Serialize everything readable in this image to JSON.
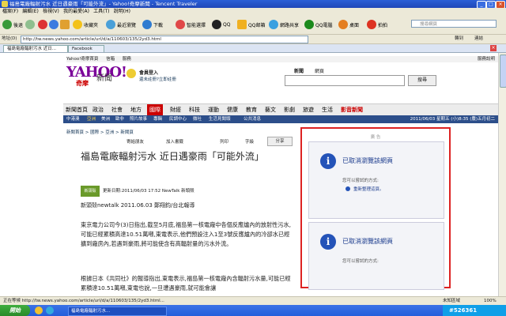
{
  "window": {
    "title": "福島電廠輻射污水 近日遇豪雨「可能外流」- Yahoo!奇摩新聞 - Tencent Traveler",
    "controls": {
      "minimize": "_",
      "maximize": "□",
      "close": "×"
    }
  },
  "menubar": [
    "檔案(F)",
    "編輯(E)",
    "檢視(V)",
    "我的最愛(A)",
    "工具(T)",
    "說明(H)"
  ],
  "toolbar": {
    "items": [
      "後退",
      "前進",
      "停止",
      "刷新",
      "主頁",
      "收藏夾",
      "最近瀏覽",
      "下載",
      "智能選擇",
      "QQ",
      "QQ邮箱",
      "網路共享",
      "QQ電腦",
      "桌面",
      "拍拍"
    ],
    "search_placeholder": "搜尋網頁"
  },
  "address": {
    "label": "地址(D)",
    "url": "http://tw.news.yahoo.com/article/url/d/a/110603/135/2yd3.html",
    "go": "轉到",
    "links_label": "連結"
  },
  "tabs": [
    {
      "label": "福島電廠輻射污水 近日...",
      "active": true
    },
    {
      "label": "Facebook",
      "active": false
    }
  ],
  "yahoo": {
    "top_links": [
      "Yahoo!奇摩首頁",
      "信箱",
      "服務"
    ],
    "top_right": "服務說明",
    "logo": "YAHOO!",
    "logo_sub": "奇摩",
    "brand": "新聞",
    "login_label": "會員登入",
    "login_hint": "還未註冊?立即註冊",
    "search_tabs": [
      "新聞",
      "網頁"
    ],
    "search_button": "搜尋",
    "nav_items": [
      "新聞首頁",
      "政治",
      "社會",
      "地方",
      "國際",
      "財經",
      "科技",
      "運動",
      "健康",
      "教育",
      "藝文",
      "影劇",
      "旅遊",
      "生活",
      "影音新聞"
    ],
    "nav_active": "國際",
    "subnav_items": [
      "中港澳",
      "亞洲",
      "美洲",
      "歐非",
      "照片故事",
      "專輯",
      "民調中心",
      "微吐",
      "生活見聞頭",
      "公共消息"
    ],
    "update_time": "2011/06/03 星期五 (小)8:35 (農)五月初二",
    "breadcrumb": "新聞首頁 > 國際 > 亞洲 > 新聞頁"
  },
  "article": {
    "tools": [
      "寄給朋友",
      "加入書籤",
      "列印"
    ],
    "font_label": "字級",
    "share_label": "分享",
    "title": "福島電廠輻射污水 近日遇豪雨「可能外流」",
    "source_logo": "新頭殼",
    "update_line": "更新日期:2011/06/03 17:52   NewTalk 新頭殼",
    "byline": "新頭殼newtalk 2011.06.03 鄭翔鈞/台北報導",
    "paragraphs": [
      "東京電力公司今(3)日指出,截至5月底,福島第一核電廠中各個反應爐內的放射性污水,可能已經累積高達10.51萬噸,東電表示,他們預設注入1至3號反應爐內的冷卻水已經擴到廠房內,若遇到豪雨,將可能使含有高輻射量的污水外流。",
      "根據日本《共同社》的報導指出,東電表示,福島第一核電廠內含輻射污水量,可能已經累積達10.51萬噸,東電也說,一旦遭遇豪雨,就可能會讓"
    ]
  },
  "sidebar": {
    "header": "廣 告",
    "blocked_title": "已取消瀏覽該網頁",
    "try_label": "您可以嘗試的方式:",
    "retry_link": "重新整理這頁。",
    "blocked_title_2": "已取消瀏覽該網頁",
    "try_label_2": "您可以嘗試的方式:"
  },
  "status": {
    "text": "正在等候 http://tw.news.yahoo.com/article/url/d/a/110603/135/2yd3.html...",
    "zone": "未知區域",
    "zoom": "100%"
  },
  "taskbar": {
    "start": "開始",
    "item": "福島電廠輻射污水...",
    "clock": "#526361"
  }
}
